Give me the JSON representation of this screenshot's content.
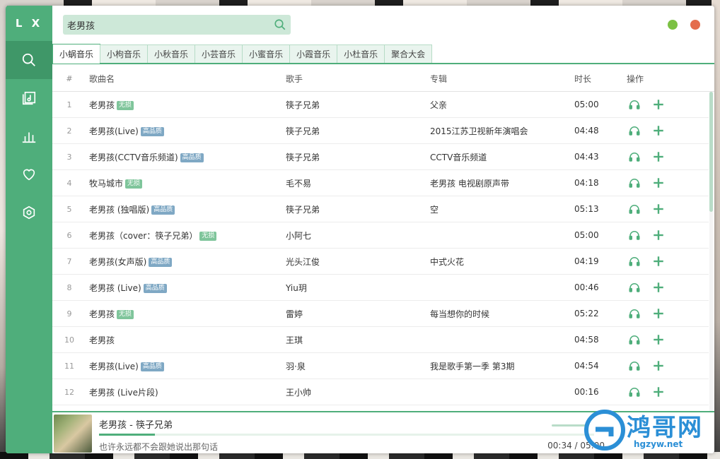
{
  "app": {
    "logo": "L X"
  },
  "sidebar": {
    "items": [
      {
        "icon": "search-icon",
        "active": true
      },
      {
        "icon": "playlist-icon",
        "active": false
      },
      {
        "icon": "chart-icon",
        "active": false
      },
      {
        "icon": "heart-icon",
        "active": false
      },
      {
        "icon": "settings-icon",
        "active": false
      }
    ]
  },
  "search": {
    "value": "老男孩"
  },
  "tabs": [
    "小蜗音乐",
    "小枸音乐",
    "小秋音乐",
    "小芸音乐",
    "小蜜音乐",
    "小霞音乐",
    "小杜音乐",
    "聚合大会"
  ],
  "table": {
    "headers": {
      "num": "#",
      "name": "歌曲名",
      "singer": "歌手",
      "album": "专辑",
      "time": "时长",
      "ops": "操作"
    },
    "rows": [
      {
        "num": "1",
        "name": "老男孩",
        "badge": "无损",
        "singer": "筷子兄弟",
        "album": "父亲",
        "time": "05:00"
      },
      {
        "num": "2",
        "name": "老男孩(Live)",
        "badge": "高品质",
        "singer": "筷子兄弟",
        "album": "2015江苏卫视新年演唱会",
        "time": "04:48"
      },
      {
        "num": "3",
        "name": "老男孩(CCTV音乐频道)",
        "badge": "高品质",
        "singer": "筷子兄弟",
        "album": "CCTV音乐频道",
        "time": "04:43"
      },
      {
        "num": "4",
        "name": "牧马城市",
        "badge": "无损",
        "singer": "毛不易",
        "album": "老男孩 电视剧原声带",
        "time": "04:18"
      },
      {
        "num": "5",
        "name": "老男孩 (独唱版)",
        "badge": "高品质",
        "singer": "筷子兄弟",
        "album": "空",
        "time": "05:13"
      },
      {
        "num": "6",
        "name": "老男孩（cover：筷子兄弟）",
        "badge": "无损",
        "singer": "小阿七",
        "album": "",
        "time": "05:00"
      },
      {
        "num": "7",
        "name": "老男孩(女声版)",
        "badge": "高品质",
        "singer": "光头江俊",
        "album": "中式火花",
        "time": "04:19"
      },
      {
        "num": "8",
        "name": "老男孩 (Live)",
        "badge": "高品质",
        "singer": "Yiu玥",
        "album": "",
        "time": "00:46"
      },
      {
        "num": "9",
        "name": "老男孩",
        "badge": "无损",
        "singer": "雷婷",
        "album": "每当想你的时候",
        "time": "05:22"
      },
      {
        "num": "10",
        "name": "老男孩",
        "badge": "",
        "singer": "王琪",
        "album": "",
        "time": "04:58"
      },
      {
        "num": "11",
        "name": "老男孩(Live)",
        "badge": "高品质",
        "singer": "羽·泉",
        "album": "我是歌手第一季 第3期",
        "time": "04:54"
      },
      {
        "num": "12",
        "name": "老男孩 (Live片段)",
        "badge": "",
        "singer": "王小帅",
        "album": "",
        "time": "00:16"
      }
    ]
  },
  "player": {
    "title": "老男孩 - 筷子兄弟",
    "lyric": "也许永远都不会跟她说出那句话",
    "time": "00:34 / 05:00",
    "progress": 0.113
  },
  "watermark": {
    "text": "鸿哥网",
    "url": "hgzyw.net"
  },
  "colors": {
    "accent": "#4fae7b",
    "accent_dark": "#3f9768",
    "search_bg": "#cde8d8"
  }
}
